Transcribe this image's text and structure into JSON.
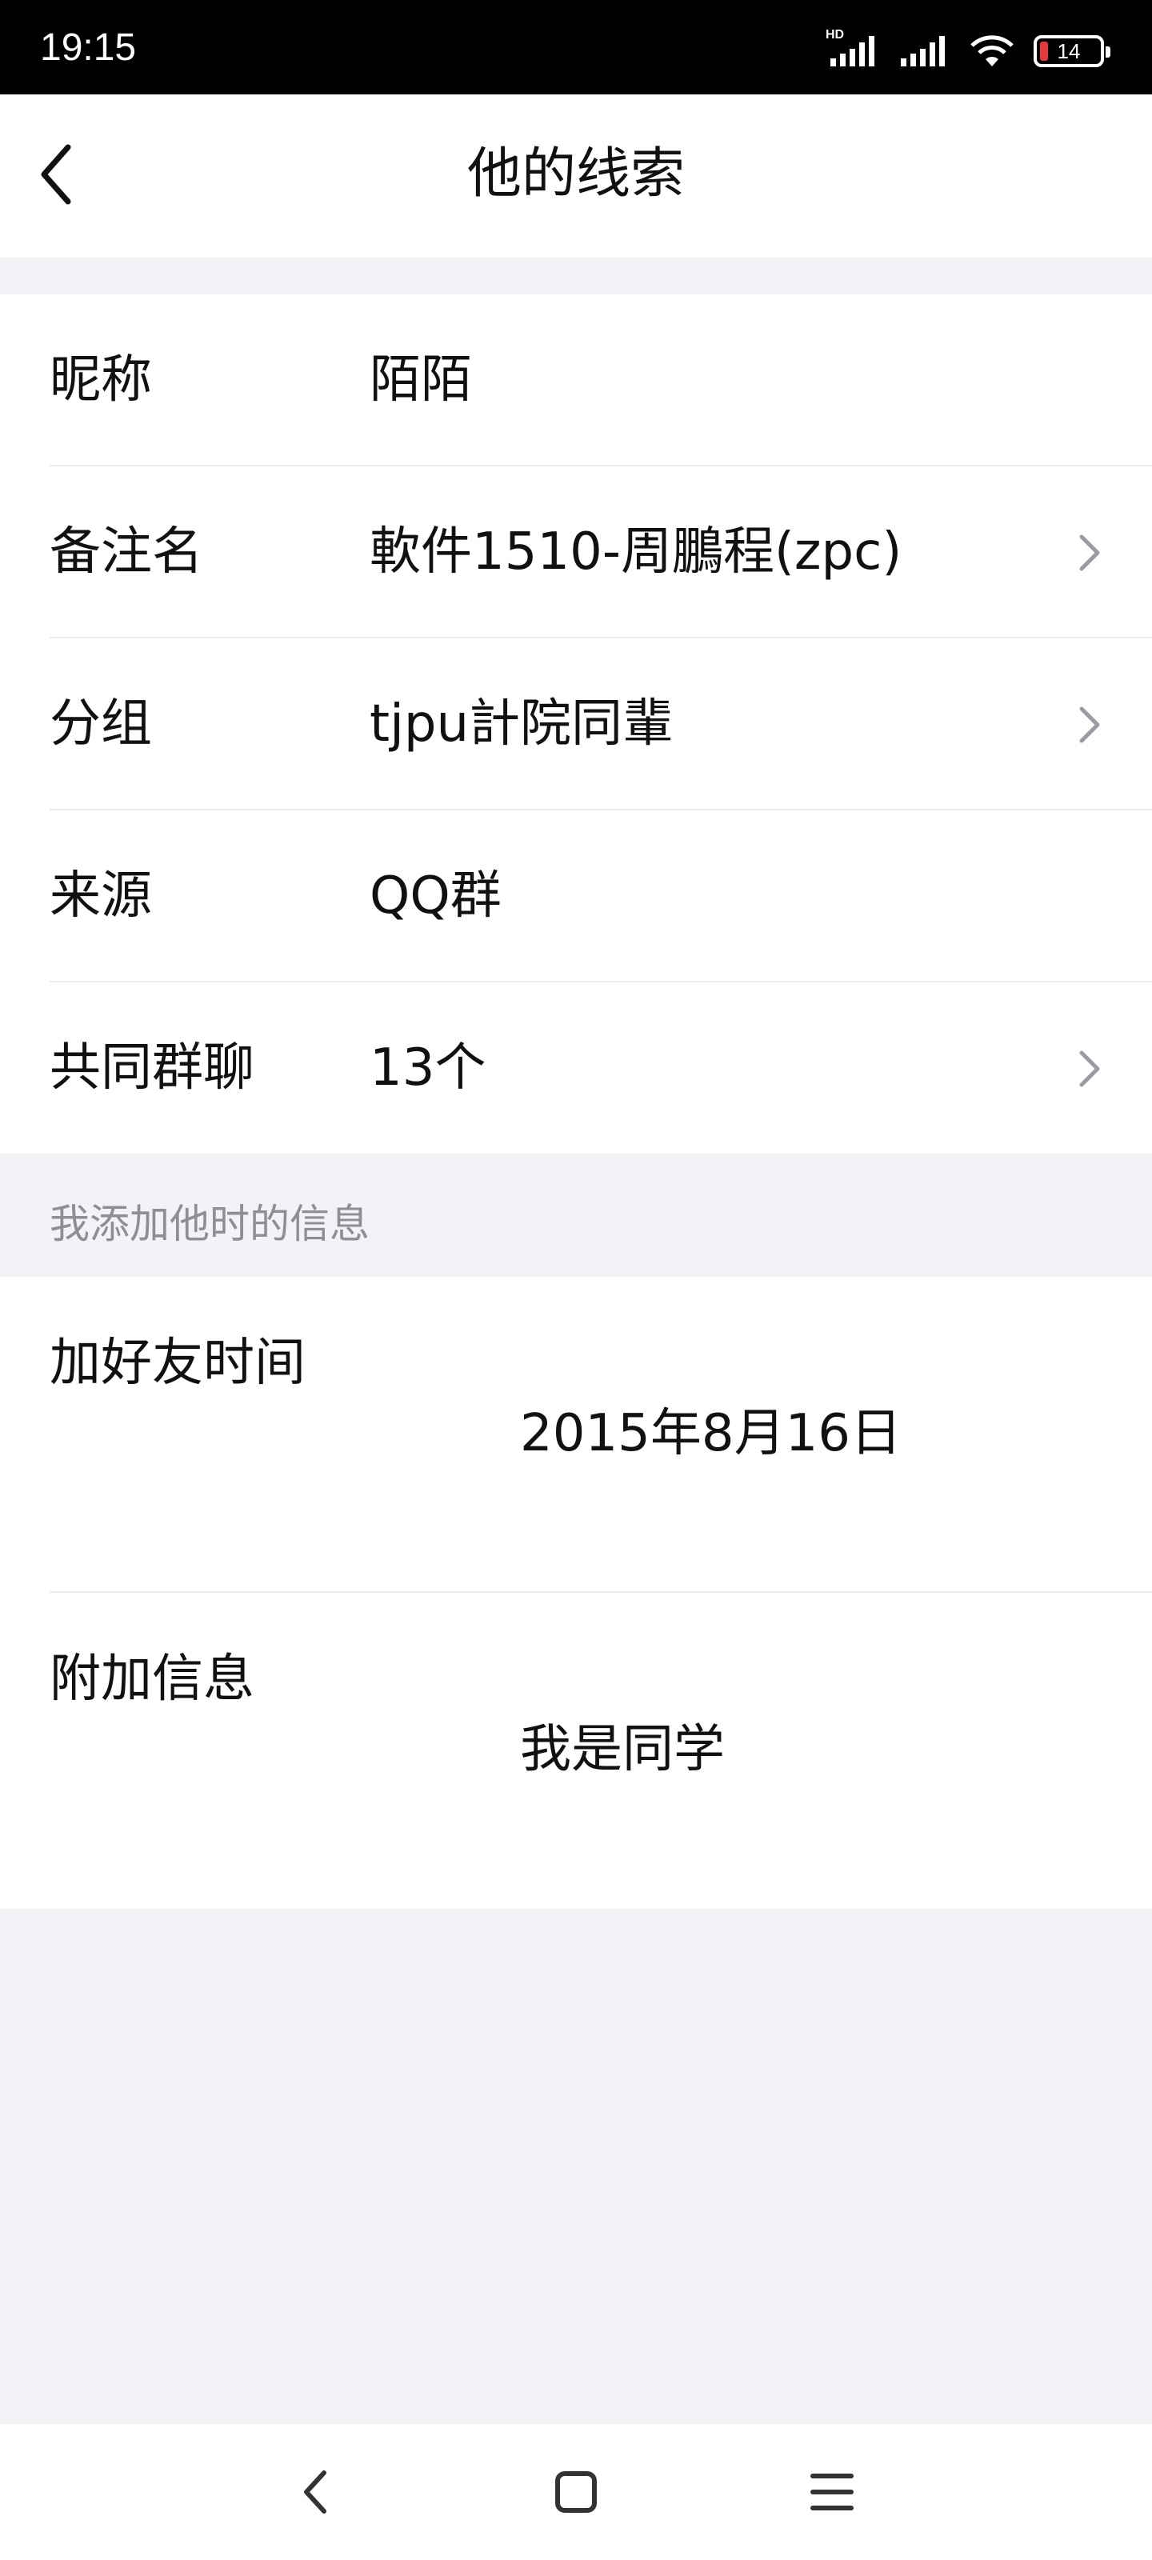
{
  "status_bar": {
    "time": "19:15",
    "network_badge": "HD",
    "battery_level": "14",
    "icons": [
      "hd-signal-icon",
      "signal-icon",
      "wifi-icon",
      "battery-icon"
    ]
  },
  "header": {
    "title": "他的线索",
    "back_icon": "chevron-left-icon"
  },
  "info_rows": [
    {
      "label": "昵称",
      "value": "陌陌",
      "has_chevron": false
    },
    {
      "label": "备注名",
      "value": "軟件1510-周鵬程(zpc)",
      "has_chevron": true
    },
    {
      "label": "分组",
      "value": "tjpu計院同輩",
      "has_chevron": true
    },
    {
      "label": "来源",
      "value": "QQ群",
      "has_chevron": false
    },
    {
      "label": "共同群聊",
      "value": "13个",
      "has_chevron": true
    }
  ],
  "section": {
    "title": "我添加他时的信息"
  },
  "detail_rows": [
    {
      "label": "加好友时间",
      "value": "2015年8月16日"
    },
    {
      "label": "附加信息",
      "value": "我是同学"
    }
  ],
  "system_nav": {
    "icons": [
      "nav-back-icon",
      "nav-home-icon",
      "nav-menu-icon"
    ]
  },
  "colors": {
    "background": "#f2f3f7",
    "card": "#ffffff",
    "text_primary": "#111111",
    "text_secondary": "#8e8e93",
    "chevron": "#9a9ca3",
    "battery_low": "#e23a3a"
  }
}
